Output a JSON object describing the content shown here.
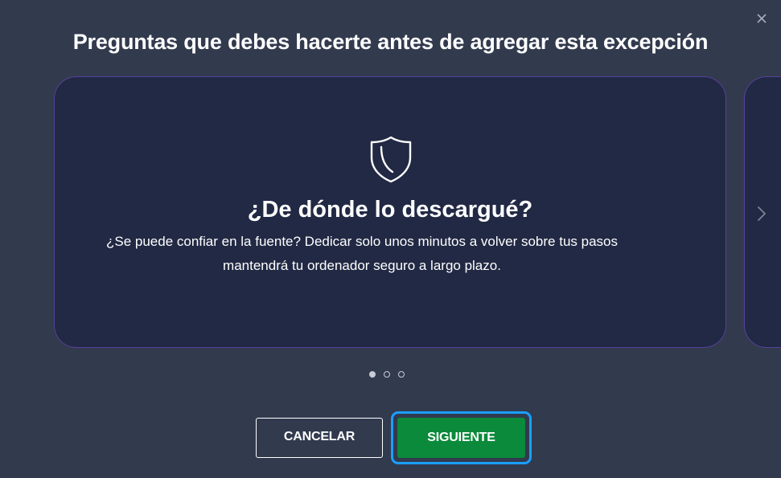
{
  "dialog": {
    "title": "Preguntas que debes hacerte antes de agregar esta excepción",
    "close_icon": "close-icon"
  },
  "card": {
    "icon": "shield-icon",
    "heading": "¿De dónde lo descargué?",
    "body": "¿Se puede confiar en la fuente? Dedicar solo unos minutos a volver sobre tus pasos mantendrá tu ordenador seguro a largo plazo."
  },
  "carousel": {
    "next_icon": "chevron-right-icon",
    "current_page": 1,
    "total_pages": 3
  },
  "buttons": {
    "cancel_label": "CANCELAR",
    "next_label": "SIGUIENTE"
  },
  "colors": {
    "background": "#323a4e",
    "card_background": "#212944",
    "card_border": "#5b3f99",
    "primary_green": "#0a8a3a",
    "focus_ring": "#1a9fff"
  }
}
